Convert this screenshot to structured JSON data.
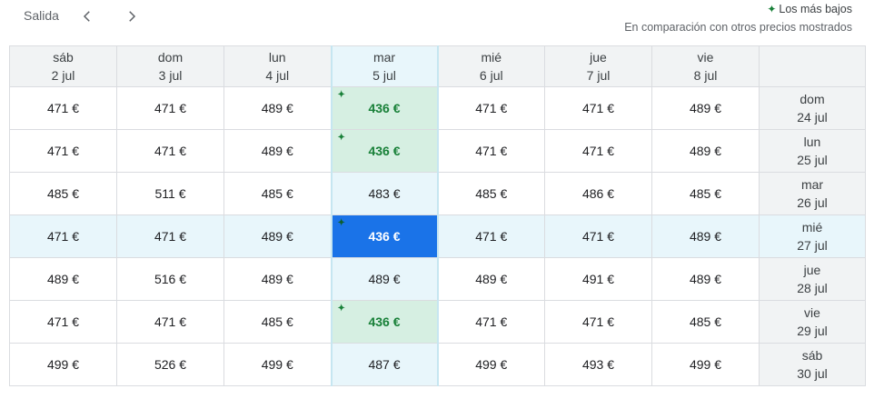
{
  "header": {
    "salida_label": "Salida",
    "prev_icon": "chevron-left-icon",
    "next_icon": "chevron-right-icon"
  },
  "legend": {
    "lowest_label": "Los más bajos",
    "comparison_label": "En comparación con otros precios mostrados",
    "lowest_color": "#188038"
  },
  "columns": [
    {
      "day": "sáb",
      "date": "2 jul"
    },
    {
      "day": "dom",
      "date": "3 jul"
    },
    {
      "day": "lun",
      "date": "4 jul"
    },
    {
      "day": "mar",
      "date": "5 jul"
    },
    {
      "day": "mié",
      "date": "6 jul"
    },
    {
      "day": "jue",
      "date": "7 jul"
    },
    {
      "day": "vie",
      "date": "8 jul"
    }
  ],
  "rows": [
    {
      "day": "dom",
      "date": "24 jul",
      "prices": [
        "471 €",
        "471 €",
        "489 €",
        "436 €",
        "471 €",
        "471 €",
        "489 €"
      ],
      "lowest": [
        3
      ]
    },
    {
      "day": "lun",
      "date": "25 jul",
      "prices": [
        "471 €",
        "471 €",
        "489 €",
        "436 €",
        "471 €",
        "471 €",
        "489 €"
      ],
      "lowest": [
        3
      ]
    },
    {
      "day": "mar",
      "date": "26 jul",
      "prices": [
        "485 €",
        "511 €",
        "485 €",
        "483 €",
        "485 €",
        "486 €",
        "485 €"
      ],
      "lowest": []
    },
    {
      "day": "mié",
      "date": "27 jul",
      "prices": [
        "471 €",
        "471 €",
        "489 €",
        "436 €",
        "471 €",
        "471 €",
        "489 €"
      ],
      "lowest": [
        3
      ]
    },
    {
      "day": "jue",
      "date": "28 jul",
      "prices": [
        "489 €",
        "516 €",
        "489 €",
        "489 €",
        "489 €",
        "491 €",
        "489 €"
      ],
      "lowest": []
    },
    {
      "day": "vie",
      "date": "29 jul",
      "prices": [
        "471 €",
        "471 €",
        "485 €",
        "436 €",
        "471 €",
        "471 €",
        "485 €"
      ],
      "lowest": [
        3
      ]
    },
    {
      "day": "sáb",
      "date": "30 jul",
      "prices": [
        "499 €",
        "526 €",
        "499 €",
        "487 €",
        "499 €",
        "493 €",
        "499 €"
      ],
      "lowest": []
    }
  ],
  "selection": {
    "column": 3,
    "row": 3
  },
  "colors": {
    "accent": "#1a73e8",
    "highlight": "#e8f6fb",
    "low_bg": "#e6f4ea"
  }
}
